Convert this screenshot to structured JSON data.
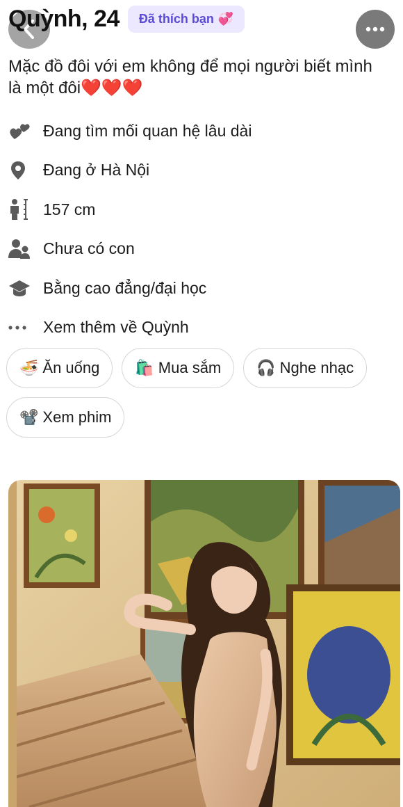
{
  "profile": {
    "name_age": "Quỳnh, 24",
    "liked_badge": "Đã thích bạn",
    "liked_badge_emoji": "💞",
    "bio": "Mặc đồ đôi với em không để mọi người biết mình là một đôi❤️❤️❤️"
  },
  "info": [
    {
      "icon": "hearts-icon",
      "text": "Đang tìm mối quan hệ lâu dài"
    },
    {
      "icon": "location-pin-icon",
      "text": "Đang ở Hà Nội"
    },
    {
      "icon": "height-icon",
      "text": "157 cm"
    },
    {
      "icon": "children-icon",
      "text": "Chưa có con"
    },
    {
      "icon": "graduation-cap-icon",
      "text": "Bằng cao đẳng/đại học"
    },
    {
      "icon": "more-dots-icon",
      "text": "Xem thêm về Quỳnh"
    }
  ],
  "interests": [
    {
      "emoji": "🍜",
      "label": "Ăn uống"
    },
    {
      "emoji": "🛍️",
      "label": "Mua sắm"
    },
    {
      "emoji": "🎧",
      "label": "Nghe nhạc"
    },
    {
      "emoji": "📽️",
      "label": "Xem phim"
    }
  ],
  "colors": {
    "badge_bg": "#ece8ff",
    "badge_text": "#5b4ad6",
    "icon": "#5a5a5a"
  }
}
